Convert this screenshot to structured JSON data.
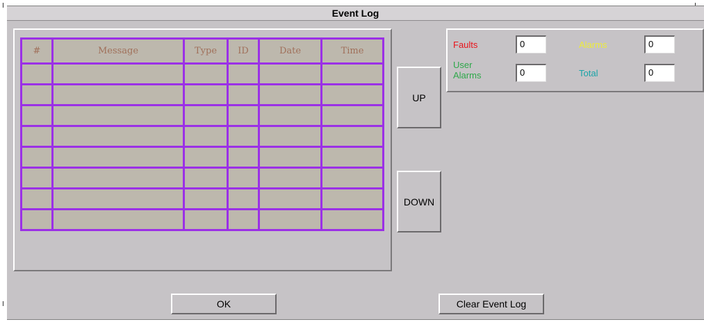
{
  "window": {
    "title": "Event Log"
  },
  "table": {
    "columns": [
      "#",
      "Message",
      "Type",
      "ID",
      "Date",
      "Time"
    ],
    "row_count": 8
  },
  "nav": {
    "up_label": "UP",
    "down_label": "DOWN"
  },
  "counts": {
    "faults": {
      "label": "Faults",
      "value": "0",
      "color": "#e8141c"
    },
    "alarms": {
      "label": "Alarms",
      "value": "0",
      "color": "#ecec3a"
    },
    "user_alarms": {
      "label": "User\nAlarms",
      "value": "0",
      "color": "#2ea84a"
    },
    "total": {
      "label": "Total",
      "value": "0",
      "color": "#1aa4a8"
    }
  },
  "footer": {
    "ok_label": "OK",
    "clear_label": "Clear Event Log"
  },
  "colors": {
    "grid_line": "#9b30e6",
    "cell_background": "#bdb8ad",
    "header_text": "#a0705a",
    "window_background": "#c6c3c6"
  }
}
